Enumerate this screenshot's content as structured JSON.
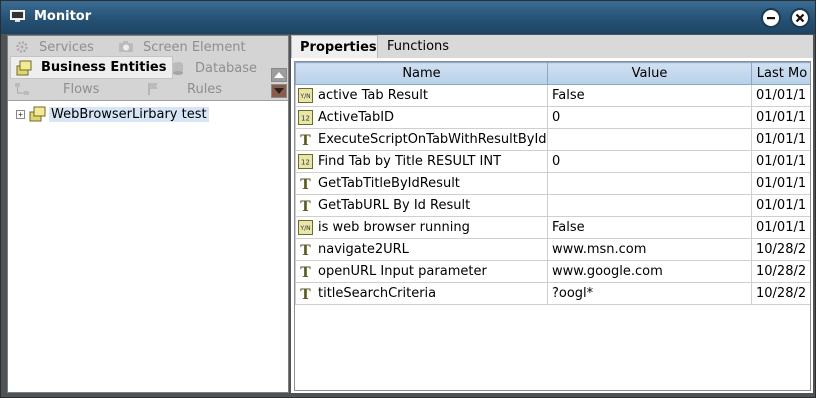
{
  "window": {
    "title": "Monitor"
  },
  "nav": {
    "services": "Services",
    "screen_element": "Screen Element",
    "business_entities": "Business Entities",
    "database": "Database",
    "flows": "Flows",
    "rules": "Rules"
  },
  "tree": {
    "root_label": "WebBrowserLirbary test",
    "expander": "+"
  },
  "tabs": {
    "properties": "Properties",
    "functions": "Functions"
  },
  "grid": {
    "headers": {
      "name": "Name",
      "value": "Value",
      "last_modified": "Last Mo"
    },
    "rows": [
      {
        "icon": "boolean-icon",
        "name": "active Tab Result",
        "value": "False",
        "last": "01/01/1"
      },
      {
        "icon": "integer-icon",
        "name": "ActiveTabID",
        "value": "0",
        "last": "01/01/1"
      },
      {
        "icon": "text-icon",
        "name": "ExecuteScriptOnTabWithResultById",
        "value": "",
        "last": "01/01/1"
      },
      {
        "icon": "integer-icon",
        "name": "Find Tab by Title RESULT INT",
        "value": "0",
        "last": "01/01/1"
      },
      {
        "icon": "text-icon",
        "name": "GetTabTitleByIdResult",
        "value": "",
        "last": "01/01/1"
      },
      {
        "icon": "text-icon",
        "name": "GetTabURL By Id Result",
        "value": "",
        "last": "01/01/1"
      },
      {
        "icon": "boolean-icon",
        "name": "is web browser running",
        "value": "False",
        "last": "01/01/1"
      },
      {
        "icon": "text-icon",
        "name": "navigate2URL",
        "value": "www.msn.com",
        "last": "10/28/2"
      },
      {
        "icon": "text-icon",
        "name": "openURL Input parameter",
        "value": "www.google.com",
        "last": "10/28/2"
      },
      {
        "icon": "text-icon",
        "name": "titleSearchCriteria",
        "value": "?oogl*",
        "last": "10/28/2"
      }
    ]
  },
  "icon_text": {
    "boolean": "Y/N",
    "integer": "12",
    "text": "T"
  }
}
